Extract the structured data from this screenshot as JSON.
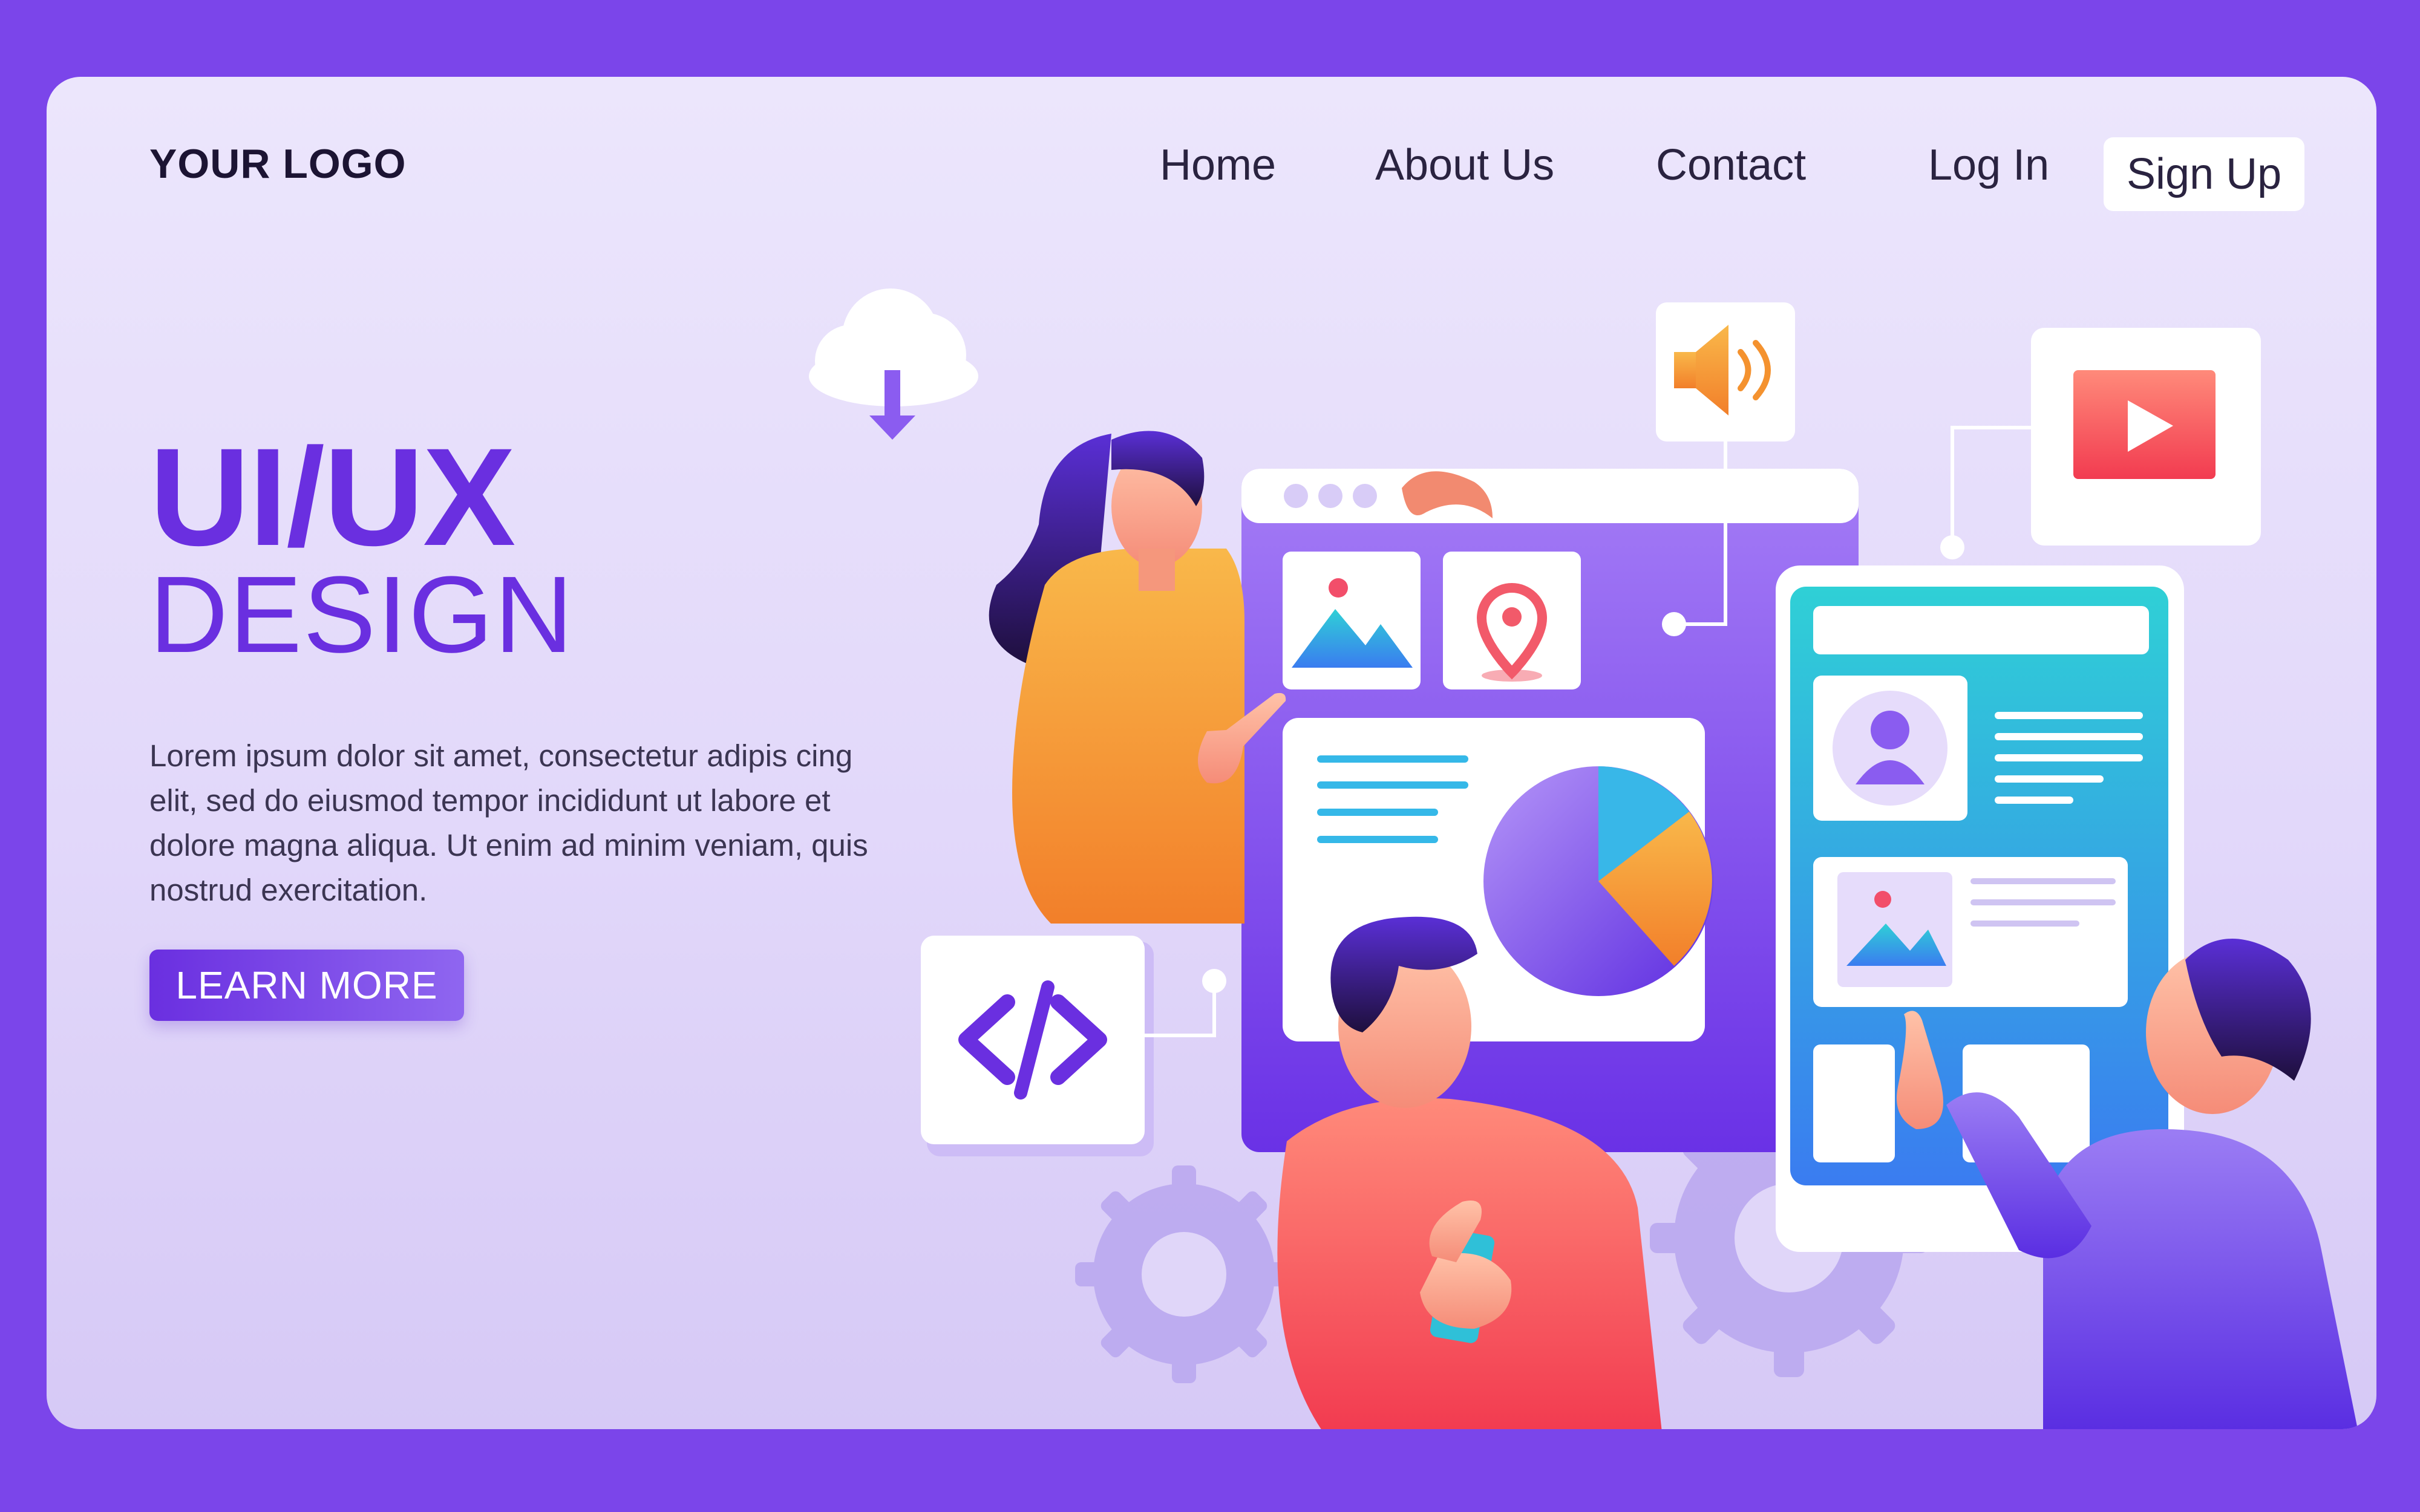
{
  "header": {
    "logo": "YOUR LOGO",
    "nav": {
      "home": "Home",
      "about": "About Us",
      "contact": "Contact",
      "login": "Log In",
      "signup": "Sign Up"
    }
  },
  "hero": {
    "title": "UI/UX",
    "subtitle": "DESIGN",
    "body": "Lorem ipsum dolor sit amet, consectetur adipis cing elit, sed do eiusmod tempor incididunt ut labore et dolore magna aliqua. Ut enim ad minim veniam, quis nostrud exercitation.",
    "cta_label": "LEARN MORE"
  },
  "colors": {
    "background": "#7b45ea",
    "accent": "#6a2fe0",
    "card": "#ece6fc"
  },
  "icons": [
    "cloud-download-icon",
    "speaker-icon",
    "play-video-icon",
    "image-icon",
    "location-pin-icon",
    "pie-chart-icon",
    "user-profile-icon",
    "code-icon",
    "gear-icon"
  ]
}
